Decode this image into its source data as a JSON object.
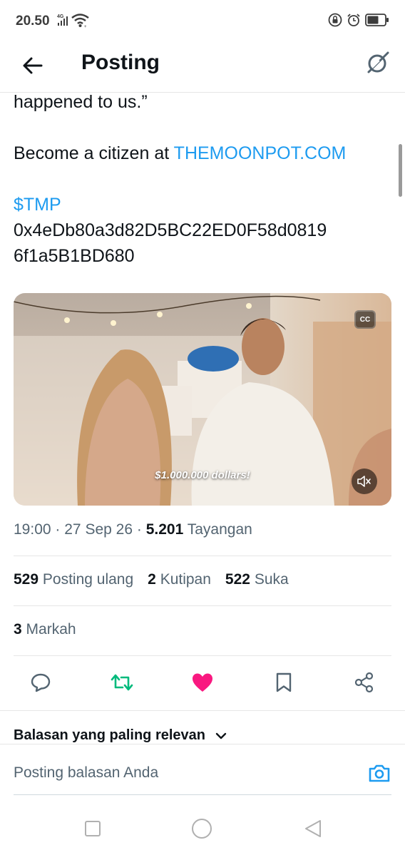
{
  "status_bar": {
    "time": "20.50",
    "network": "4G",
    "icons": [
      "signal-icon",
      "wifi-icon",
      "lock-icon",
      "alarm-icon",
      "battery-icon"
    ]
  },
  "header": {
    "title": "Posting",
    "back_icon": "arrow-left-icon",
    "grok_icon": "grok-icon"
  },
  "tweet": {
    "line1": "happened to us.”",
    "line2_prefix": "Become a citizen at ",
    "line2_link": "THEMOONPOT.COM",
    "cashtag": "$TMP",
    "address_line1": "0x4eDb80a3d82D5BC22ED0F58d0819",
    "address_line2": "6f1a5B1BD680"
  },
  "video": {
    "cc_label": "CC",
    "caption": "$1.000.000 dollars!",
    "muted": true
  },
  "meta": {
    "time": "19:00",
    "separator": "·",
    "date": "27 Sep 26",
    "views_count": "5.201",
    "views_label": "Tayangan"
  },
  "stats": {
    "reposts_count": "529",
    "reposts_label": "Posting ulang",
    "quotes_count": "2",
    "quotes_label": "Kutipan",
    "likes_count": "522",
    "likes_label": "Suka",
    "bookmarks_count": "3",
    "bookmarks_label": "Markah"
  },
  "actions": [
    "reply-icon",
    "repost-icon",
    "like-icon",
    "bookmark-icon",
    "share-icon"
  ],
  "colors": {
    "link": "#1d9bf0",
    "repost": "#00ba7c",
    "like": "#f91880",
    "text_primary": "#0f1419",
    "text_secondary": "#536471"
  },
  "replies": {
    "sort_label": "Balasan yang paling relevan"
  },
  "composer": {
    "placeholder": "Posting balasan Anda"
  },
  "navbar": [
    "recent-apps-icon",
    "home-icon",
    "back-icon"
  ]
}
